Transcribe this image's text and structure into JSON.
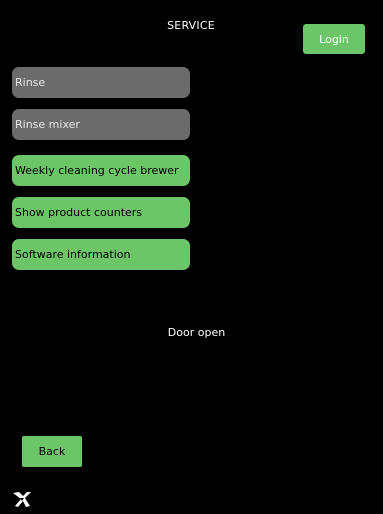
{
  "header": {
    "title": "SERVICE",
    "login_label": "Login"
  },
  "menu": {
    "items": [
      {
        "label": "Rinse",
        "state": "disabled"
      },
      {
        "label": "Rinse mixer",
        "state": "disabled"
      },
      {
        "label": "Weekly cleaning cycle brewer",
        "state": "enabled"
      },
      {
        "label": "Show product counters",
        "state": "enabled"
      },
      {
        "label": "Software information",
        "state": "enabled"
      }
    ]
  },
  "status": {
    "message": "Door open"
  },
  "footer": {
    "back_label": "Back",
    "logo_icon": "brand-logo-icon"
  },
  "colors": {
    "background": "#000000",
    "button_enabled": "#6cc668",
    "button_disabled": "#6b6b6b",
    "text": "#ffffff"
  }
}
